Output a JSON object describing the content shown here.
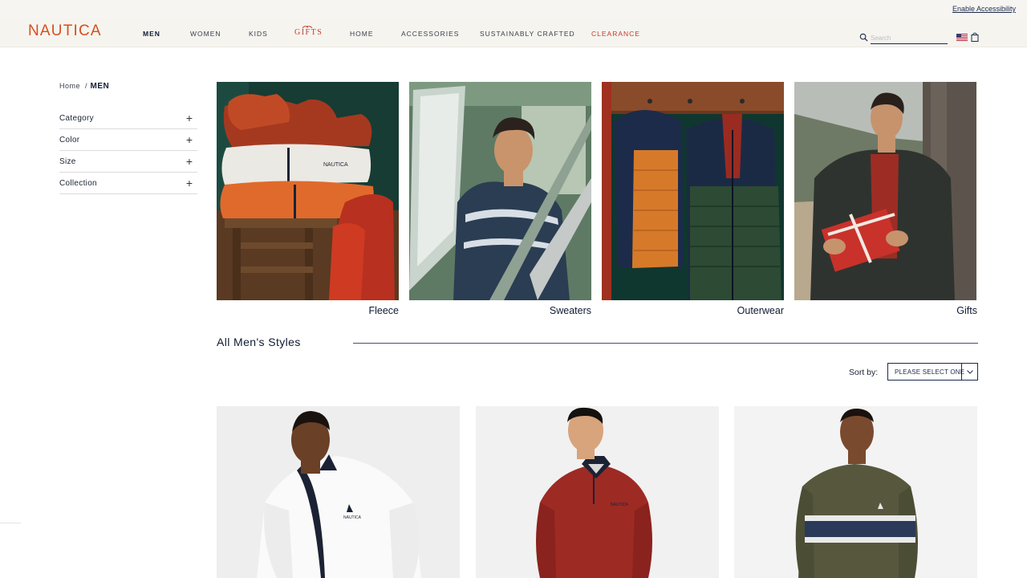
{
  "topbar": {
    "accessibility_link": "Enable Accessibility"
  },
  "header": {
    "logo": "NAUTICA",
    "nav": [
      {
        "label": "MEN"
      },
      {
        "label": "WOMEN"
      },
      {
        "label": "KIDS"
      },
      {
        "label": "GIFTS"
      },
      {
        "label": "HOME"
      },
      {
        "label": "ACCESSORIES"
      },
      {
        "label": "SUSTAINABLY CRAFTED"
      },
      {
        "label": "CLEARANCE"
      }
    ],
    "search_placeholder": "Search",
    "icons": [
      "search-icon",
      "us-flag-icon",
      "shopping-bag-icon"
    ]
  },
  "breadcrumb": {
    "home": "Home",
    "separator": "/",
    "current": "MEN"
  },
  "filters": [
    {
      "label": "Category",
      "icon": "plus-icon"
    },
    {
      "label": "Color",
      "icon": "plus-icon"
    },
    {
      "label": "Size",
      "icon": "plus-icon"
    },
    {
      "label": "Collection",
      "icon": "plus-icon"
    }
  ],
  "categories": [
    {
      "label": "Fleece"
    },
    {
      "label": "Sweaters"
    },
    {
      "label": "Outerwear"
    },
    {
      "label": "Gifts"
    }
  ],
  "section": {
    "title": "All Men's Styles"
  },
  "sort": {
    "label": "Sort by:",
    "selected": "PLEASE SELECT ONE"
  },
  "colors": {
    "brand": "#d4501f",
    "navy": "#0e1b33",
    "sale_red": "#c43b2a",
    "header_bg": "#f6f4ef"
  }
}
